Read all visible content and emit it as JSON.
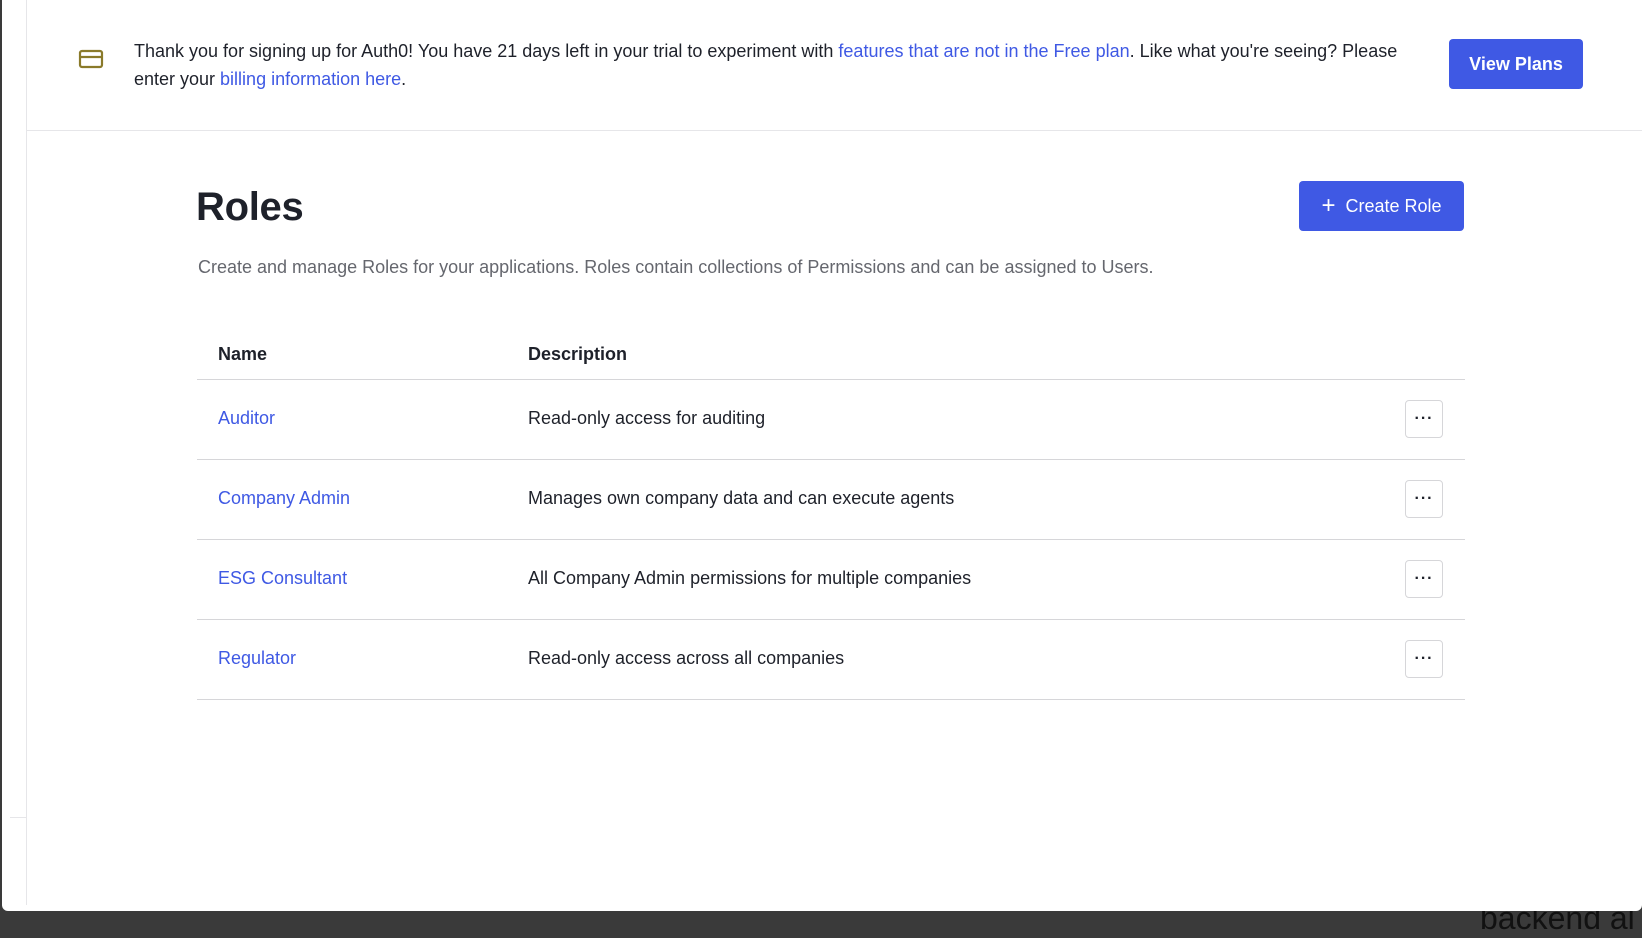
{
  "banner": {
    "text_part1": "Thank you for signing up for Auth0! You have 21 days left in your trial to experiment with ",
    "link_features": "features that are not in the Free plan",
    "text_part2": ". Like what you're seeing? Please enter your ",
    "link_billing": "billing information here",
    "text_part3": ".",
    "button_label": "View Plans",
    "icon": "credit-card-icon"
  },
  "header": {
    "title": "Roles",
    "description": "Create and manage Roles for your applications. Roles contain collections of Permissions and can be assigned to Users.",
    "create_button_icon": "+",
    "create_button_label": "Create Role"
  },
  "table": {
    "columns": [
      "Name",
      "Description"
    ],
    "rows": [
      {
        "name": "Auditor",
        "description": "Read-only access for auditing",
        "action": "···"
      },
      {
        "name": "Company Admin",
        "description": "Manages own company data and can execute agents",
        "action": "···"
      },
      {
        "name": "ESG Consultant",
        "description": "All Company Admin permissions for multiple companies",
        "action": "···"
      },
      {
        "name": "Regulator",
        "description": "Read-only access across all companies",
        "action": "···"
      }
    ]
  },
  "background": {
    "partial_text": "backend al"
  },
  "colors": {
    "accent": "#3f59e4",
    "text": "#1e212a",
    "muted": "#65676e",
    "border": "#d6d6d9",
    "card_icon": "#8a7a2a"
  }
}
